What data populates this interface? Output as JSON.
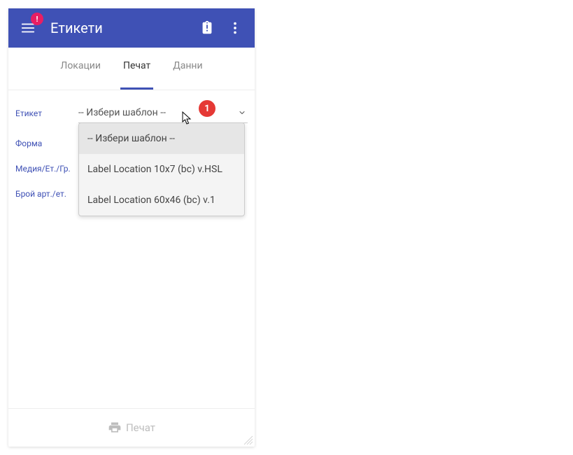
{
  "colors": {
    "primary": "#3f51b5",
    "badge": "#e91e63",
    "callout": "#e53935",
    "disabled": "#bdbdbd"
  },
  "appbar": {
    "title": "Етикети",
    "menu_badge": "!"
  },
  "tabs": [
    {
      "label": "Локации",
      "active": false
    },
    {
      "label": "Печат",
      "active": true
    },
    {
      "label": "Данни",
      "active": false
    }
  ],
  "form": {
    "rows": [
      {
        "label": "Етикет"
      },
      {
        "label": "Форма"
      },
      {
        "label": "Медия/Ет./Гр."
      },
      {
        "label": "Брой арт./ет."
      }
    ],
    "template_select": {
      "value": "-- Избери шаблон --",
      "options": [
        "-- Избери шаблон --",
        "Label Location 10x7 (bc) v.HSL",
        "Label Location 60x46 (bc) v.1"
      ]
    }
  },
  "callout": {
    "number": "1"
  },
  "footer": {
    "print_label": "Печат"
  }
}
